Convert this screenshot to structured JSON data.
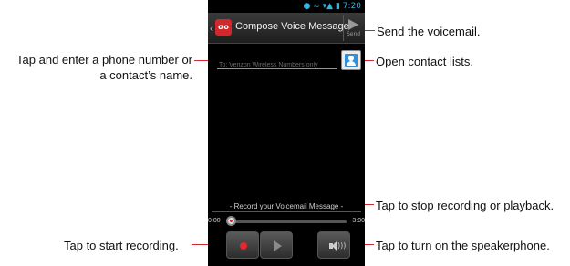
{
  "status_bar": {
    "time": "7:20"
  },
  "action_bar": {
    "title": "Compose Voice Message",
    "send_label": "Send",
    "app_icon_glyph": "σο"
  },
  "compose": {
    "to_placeholder": "To: Verizon Wireless Numbers only"
  },
  "recorder": {
    "label": "- Record your Voicemail Message -",
    "start_time": "0:00",
    "end_time": "3:00"
  },
  "callouts": {
    "send": "Send the voicemail.",
    "open_contacts": "Open contact lists.",
    "enter_number_line1": "Tap and enter a phone number or",
    "enter_number_line2": "a contact’s name.",
    "stop": "Tap to stop recording or playback.",
    "start": "Tap to start recording.",
    "speaker": "Tap to turn on the speakerphone."
  },
  "icons": [
    "voicemail-app-icon",
    "send-icon",
    "contact-icon",
    "record-icon",
    "play-icon",
    "speaker-icon"
  ],
  "colors": {
    "callout_line": "#d0282c",
    "accent": "#33b5e5",
    "record": "#e8262c"
  }
}
